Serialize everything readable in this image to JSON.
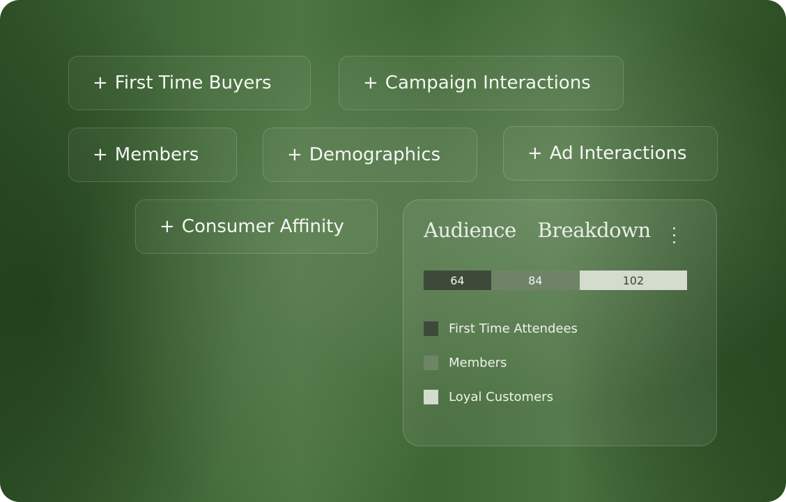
{
  "chips": [
    {
      "label": "First Time Buyers"
    },
    {
      "label": "Campaign Interactions"
    },
    {
      "label": "Members"
    },
    {
      "label": "Demographics"
    },
    {
      "label": "Ad Interactions"
    },
    {
      "label": "Consumer Affinity"
    }
  ],
  "plus_symbol": "+",
  "card": {
    "title": "Audience Breakdown",
    "menu_icon": "vertical-ellipsis-icon"
  },
  "chart_data": {
    "type": "bar",
    "stacked": true,
    "orientation": "horizontal",
    "series": [
      {
        "name": "First Time Attendees",
        "value": 64,
        "color": "#3d4a3a"
      },
      {
        "name": "Members",
        "value": 84,
        "color": "#6f8466"
      },
      {
        "name": "Loyal Customers",
        "value": 102,
        "color": "#d3dccd"
      }
    ],
    "data_labels": [
      "64",
      "84",
      "102"
    ],
    "legend": "bottom-left"
  }
}
